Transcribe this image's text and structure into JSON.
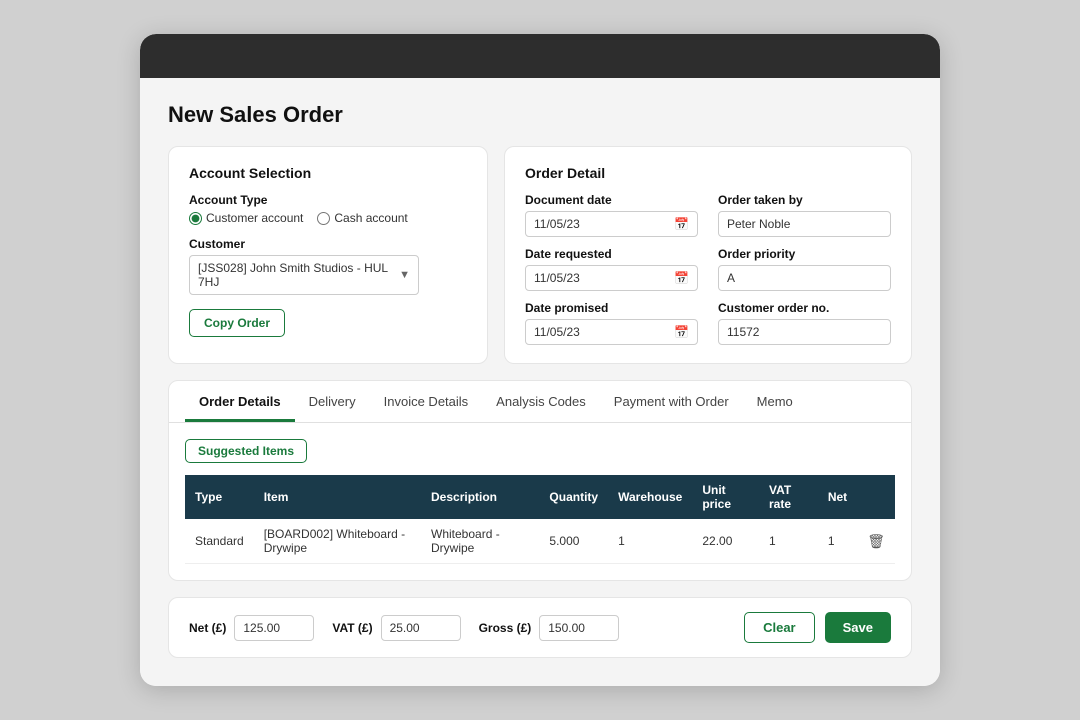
{
  "page": {
    "title": "New Sales Order"
  },
  "account_selection": {
    "panel_title": "Account Selection",
    "account_type_label": "Account Type",
    "radio_options": [
      {
        "id": "customer",
        "label": "Customer account",
        "checked": true
      },
      {
        "id": "cash",
        "label": "Cash account",
        "checked": false
      }
    ],
    "customer_label": "Customer",
    "customer_value": "[JSS028] John Smith Studios - HUL 7HJ",
    "copy_order_btn": "Copy Order"
  },
  "order_detail": {
    "panel_title": "Order Detail",
    "document_date_label": "Document date",
    "document_date_value": "11/05/23",
    "order_taken_by_label": "Order taken by",
    "order_taken_by_value": "Peter Noble",
    "date_requested_label": "Date requested",
    "date_requested_value": "11/05/23",
    "order_priority_label": "Order priority",
    "order_priority_value": "A",
    "date_promised_label": "Date promised",
    "date_promised_value": "11/05/23",
    "customer_order_no_label": "Customer order no.",
    "customer_order_no_value": "11572"
  },
  "tabs": [
    {
      "id": "order-details",
      "label": "Order Details",
      "active": true
    },
    {
      "id": "delivery",
      "label": "Delivery",
      "active": false
    },
    {
      "id": "invoice-details",
      "label": "Invoice Details",
      "active": false
    },
    {
      "id": "analysis-codes",
      "label": "Analysis Codes",
      "active": false
    },
    {
      "id": "payment-with-order",
      "label": "Payment with Order",
      "active": false
    },
    {
      "id": "memo",
      "label": "Memo",
      "active": false
    }
  ],
  "suggested_items": {
    "badge_label": "Suggested Items",
    "table_headers": [
      "Type",
      "Item",
      "Description",
      "Quantity",
      "Warehouse",
      "Unit price",
      "VAT rate",
      "Net",
      ""
    ],
    "rows": [
      {
        "type": "Standard",
        "item": "[BOARD002] Whiteboard - Drywipe",
        "description": "Whiteboard - Drywipe",
        "quantity": "5.000",
        "warehouse": "1",
        "unit_price": "22.00",
        "vat_rate": "1",
        "net": "1"
      }
    ]
  },
  "footer": {
    "net_label": "Net (£)",
    "net_value": "125.00",
    "vat_label": "VAT (£)",
    "vat_value": "25.00",
    "gross_label": "Gross (£)",
    "gross_value": "150.00",
    "clear_btn": "Clear",
    "save_btn": "Save"
  },
  "colors": {
    "accent": "#1a7a3c",
    "header_dark": "#2d2d2d",
    "table_header": "#1a3a4a"
  }
}
